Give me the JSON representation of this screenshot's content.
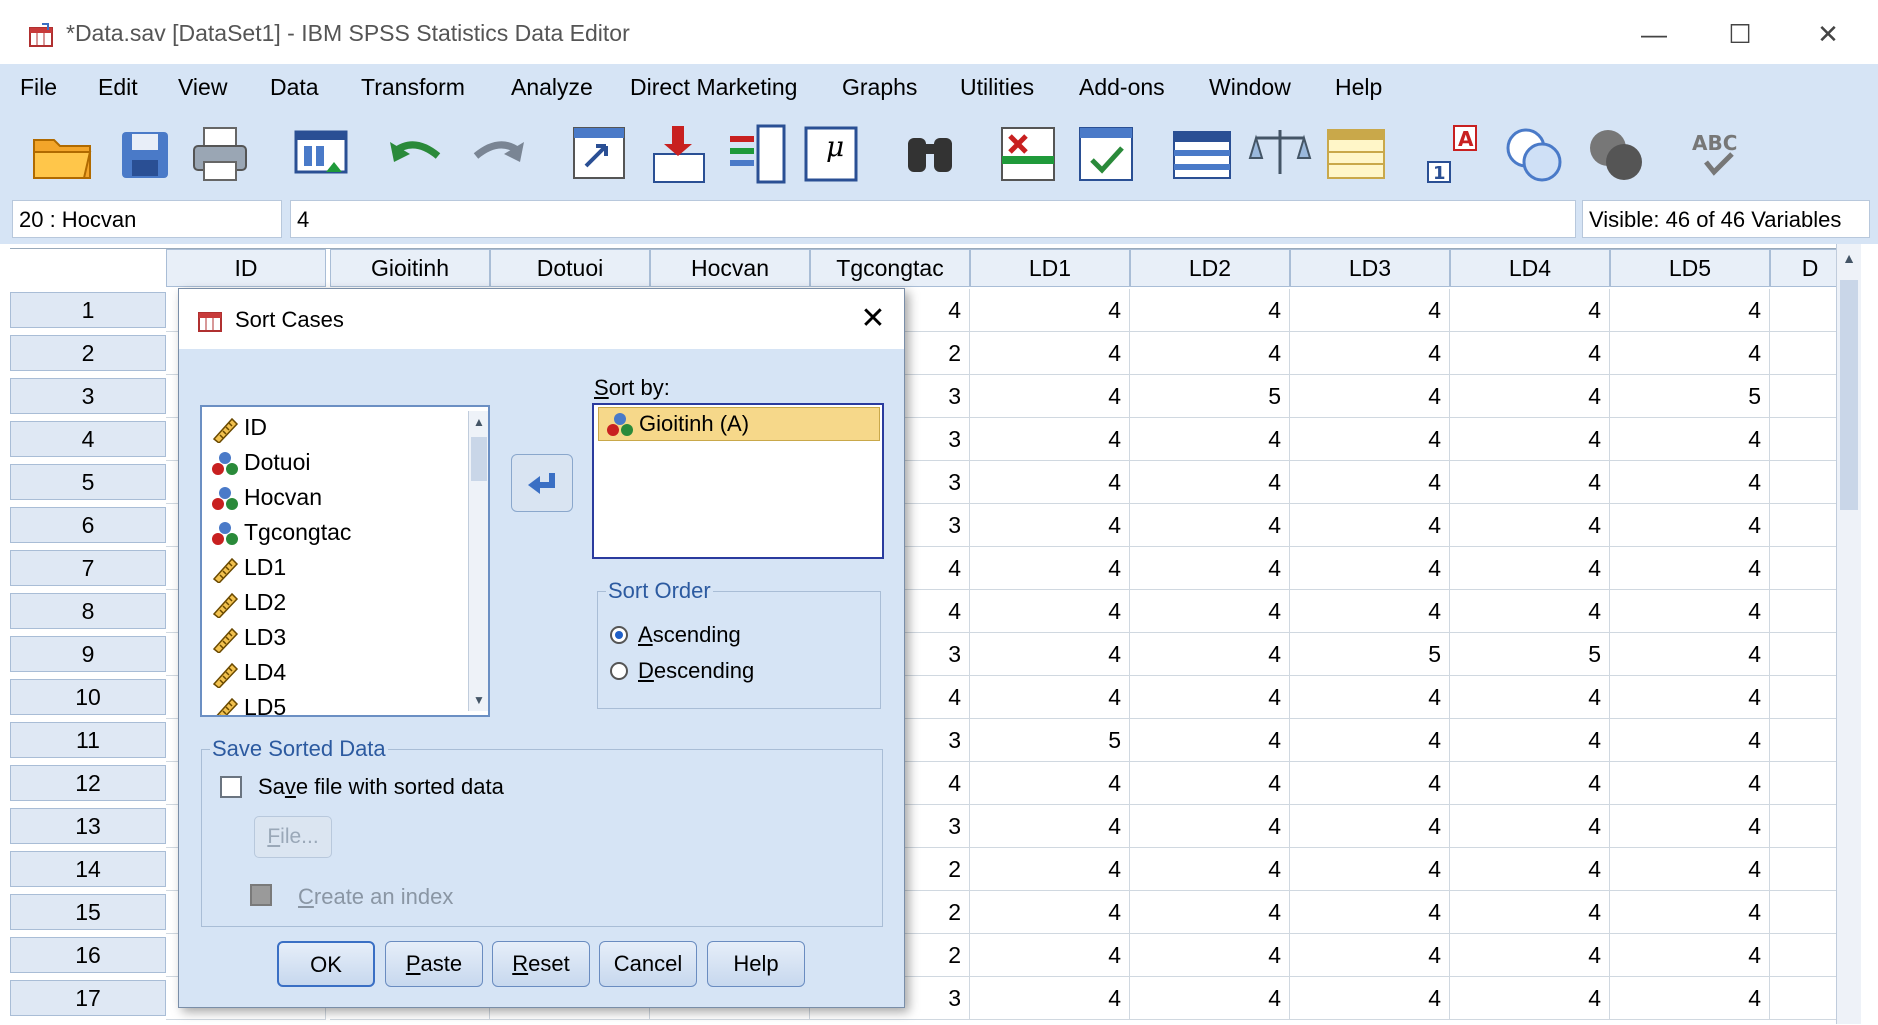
{
  "window": {
    "title": "*Data.sav [DataSet1] - IBM SPSS Statistics Data Editor",
    "minimize_glyph": "—",
    "maximize_glyph": "☐",
    "close_glyph": "✕"
  },
  "menu": [
    {
      "label": "File"
    },
    {
      "label": "Edit"
    },
    {
      "label": "View"
    },
    {
      "label": "Data"
    },
    {
      "label": "Transform"
    },
    {
      "label": "Analyze"
    },
    {
      "label": "Direct Marketing"
    },
    {
      "label": "Graphs"
    },
    {
      "label": "Utilities"
    },
    {
      "label": "Add-ons"
    },
    {
      "label": "Window"
    },
    {
      "label": "Help"
    }
  ],
  "toolbar": {
    "icons": [
      "open-folder-icon",
      "save-icon",
      "print-icon",
      "dialog-recall-icon",
      "undo-icon",
      "redo-icon",
      "goto-case-icon",
      "goto-variable-icon",
      "variables-icon",
      "descriptives-icon",
      "find-icon",
      "insert-cases-icon",
      "insert-variable-icon",
      "split-file-icon",
      "weight-cases-icon",
      "select-cases-icon",
      "value-labels-icon",
      "use-variable-sets-icon",
      "show-all-variables-icon",
      "spell-check-icon"
    ]
  },
  "cellbar": {
    "cell_ref": "20 : Hocvan",
    "cell_value": "4",
    "visible_vars": "Visible: 46 of 46 Variables"
  },
  "grid": {
    "columns": [
      "ID",
      "Gioitinh",
      "Dotuoi",
      "Hocvan",
      "Tgcongtac",
      "LD1",
      "LD2",
      "LD3",
      "LD4",
      "LD5",
      "D"
    ],
    "rows": [
      {
        "n": "1",
        "tg": "4",
        "ld1": "4",
        "ld2": "4",
        "ld3": "4",
        "ld4": "4",
        "ld5": "4"
      },
      {
        "n": "2",
        "tg": "2",
        "ld1": "4",
        "ld2": "4",
        "ld3": "4",
        "ld4": "4",
        "ld5": "4"
      },
      {
        "n": "3",
        "tg": "3",
        "ld1": "4",
        "ld2": "5",
        "ld3": "4",
        "ld4": "4",
        "ld5": "5"
      },
      {
        "n": "4",
        "tg": "3",
        "ld1": "4",
        "ld2": "4",
        "ld3": "4",
        "ld4": "4",
        "ld5": "4"
      },
      {
        "n": "5",
        "tg": "3",
        "ld1": "4",
        "ld2": "4",
        "ld3": "4",
        "ld4": "4",
        "ld5": "4"
      },
      {
        "n": "6",
        "tg": "3",
        "ld1": "4",
        "ld2": "4",
        "ld3": "4",
        "ld4": "4",
        "ld5": "4"
      },
      {
        "n": "7",
        "tg": "4",
        "ld1": "4",
        "ld2": "4",
        "ld3": "4",
        "ld4": "4",
        "ld5": "4"
      },
      {
        "n": "8",
        "tg": "4",
        "ld1": "4",
        "ld2": "4",
        "ld3": "4",
        "ld4": "4",
        "ld5": "4"
      },
      {
        "n": "9",
        "tg": "3",
        "ld1": "4",
        "ld2": "4",
        "ld3": "5",
        "ld4": "5",
        "ld5": "4"
      },
      {
        "n": "10",
        "tg": "4",
        "ld1": "4",
        "ld2": "4",
        "ld3": "4",
        "ld4": "4",
        "ld5": "4"
      },
      {
        "n": "11",
        "tg": "3",
        "ld1": "5",
        "ld2": "4",
        "ld3": "4",
        "ld4": "4",
        "ld5": "4"
      },
      {
        "n": "12",
        "tg": "4",
        "ld1": "4",
        "ld2": "4",
        "ld3": "4",
        "ld4": "4",
        "ld5": "4"
      },
      {
        "n": "13",
        "tg": "3",
        "ld1": "4",
        "ld2": "4",
        "ld3": "4",
        "ld4": "4",
        "ld5": "4"
      },
      {
        "n": "14",
        "tg": "2",
        "ld1": "4",
        "ld2": "4",
        "ld3": "4",
        "ld4": "4",
        "ld5": "4"
      },
      {
        "n": "15",
        "tg": "2",
        "ld1": "4",
        "ld2": "4",
        "ld3": "4",
        "ld4": "4",
        "ld5": "4"
      },
      {
        "n": "16",
        "tg": "2",
        "ld1": "4",
        "ld2": "4",
        "ld3": "4",
        "ld4": "4",
        "ld5": "4"
      },
      {
        "n": "17",
        "tg": "3",
        "ld1": "4",
        "ld2": "4",
        "ld3": "4",
        "ld4": "4",
        "ld5": "4"
      }
    ]
  },
  "dialog": {
    "title": "Sort Cases",
    "close_glyph": "✕",
    "variables": [
      {
        "name": "ID",
        "icon": "scale-ruler-icon"
      },
      {
        "name": "Dotuoi",
        "icon": "nominal-icon"
      },
      {
        "name": "Hocvan",
        "icon": "nominal-icon"
      },
      {
        "name": "Tgcongtac",
        "icon": "nominal-icon"
      },
      {
        "name": "LD1",
        "icon": "scale-ruler-icon"
      },
      {
        "name": "LD2",
        "icon": "scale-ruler-icon"
      },
      {
        "name": "LD3",
        "icon": "scale-ruler-icon"
      },
      {
        "name": "LD4",
        "icon": "scale-ruler-icon"
      },
      {
        "name": "LD5",
        "icon": "scale-ruler-icon"
      }
    ],
    "sort_by_label": "Sort by:",
    "sort_by_items": [
      "Gioitinh (A)"
    ],
    "sort_order_title": "Sort Order",
    "ascending": "Ascending",
    "descending": "Descending",
    "selected_order": "Ascending",
    "save_group_title": "Save Sorted Data",
    "save_file_label": "Save file with sorted data",
    "save_file_checked": false,
    "file_button": "File...",
    "create_index_label": "Create an index",
    "buttons": {
      "ok": "OK",
      "paste": "Paste",
      "reset": "Reset",
      "cancel": "Cancel",
      "help": "Help"
    }
  }
}
